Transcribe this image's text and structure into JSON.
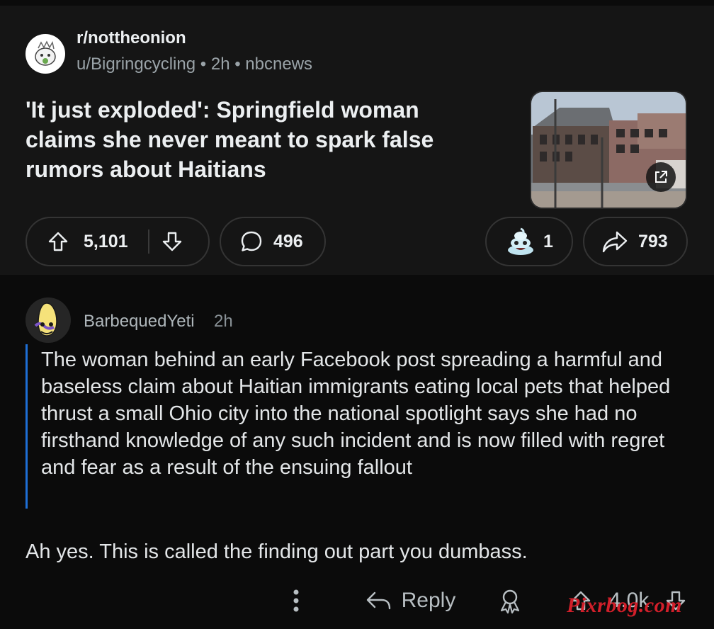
{
  "post": {
    "subreddit": "r/nottheonion",
    "author": "u/Bigringcycling",
    "sep1": "•",
    "time": "2h",
    "sep2": "•",
    "source": "nbcnews",
    "title": "'It just exploded': Springfield woman claims she never meant to spark false rumors about Haitians",
    "upvotes": "5,101",
    "comments": "496",
    "awards": "1",
    "shares": "793",
    "icons": {
      "upvote": "arrow-up-icon",
      "downvote": "arrow-down-icon",
      "comment": "speech-bubble-icon",
      "award": "award-emoji-icon",
      "share": "share-arrow-icon",
      "external": "external-link-icon"
    }
  },
  "comment": {
    "author": "BarbequedYeti",
    "time": "2h",
    "quote": "The woman behind an early Facebook post spreading a harmful and baseless claim about Haitian immigrants eating local pets that helped thrust a small Ohio city into the national spotlight says she had no firsthand knowledge of any such incident and is now filled with regret and fear as a result of the ensuing fallout",
    "body": "Ah yes. This is called the finding out part you dumbass.",
    "reply_label": "Reply",
    "score": "4.0k",
    "icons": {
      "more": "vertical-dots-icon",
      "reply": "reply-arrow-icon",
      "award": "award-ribbon-icon",
      "upvote": "arrow-up-icon",
      "downvote": "arrow-down-icon"
    }
  },
  "watermark": "Pixrbog.com",
  "colors": {
    "background": "#0b0b0b",
    "post_card": "#151515",
    "quote_bar": "#1e6fd6",
    "watermark": "#d21f2a"
  }
}
